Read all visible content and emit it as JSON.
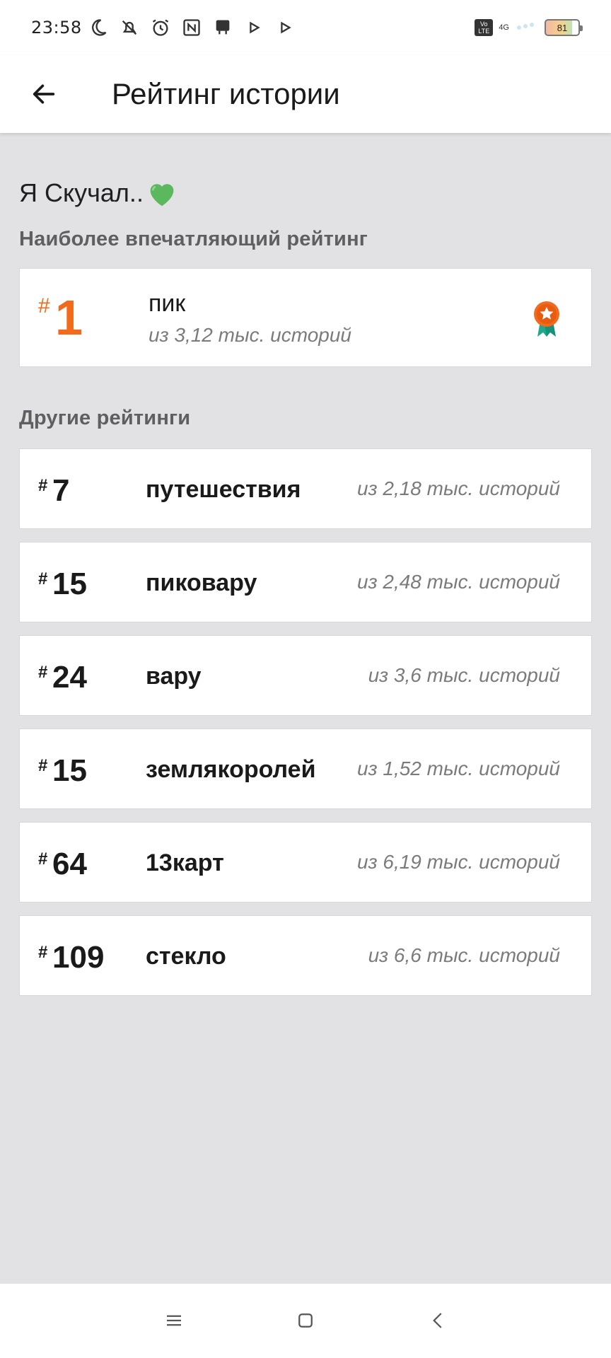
{
  "status_bar": {
    "time": "23:58",
    "volte": "Vo LTE",
    "signal": "4G",
    "battery": "81"
  },
  "app_bar": {
    "title": "Рейтинг истории"
  },
  "story": {
    "title": "Я Скучал.."
  },
  "top_section": {
    "label": "Наиболее впечатляющий рейтинг",
    "hash": "#",
    "rank": "1",
    "tag": "пик",
    "of_text": "из 3,12 тыс. историй"
  },
  "other_section": {
    "label": "Другие рейтинги",
    "items": [
      {
        "hash": "#",
        "rank": "7",
        "tag": "путешествия",
        "of_text": "из 2,18 тыс. историй"
      },
      {
        "hash": "#",
        "rank": "15",
        "tag": "пиковару",
        "of_text": "из 2,48 тыс. историй"
      },
      {
        "hash": "#",
        "rank": "24",
        "tag": "вару",
        "of_text": "из 3,6 тыс. историй"
      },
      {
        "hash": "#",
        "rank": "15",
        "tag": "землякоролей",
        "of_text": "из 1,52 тыс. историй"
      },
      {
        "hash": "#",
        "rank": "64",
        "tag": "13карт",
        "of_text": "из 6,19 тыс. историй"
      },
      {
        "hash": "#",
        "rank": "109",
        "tag": "стекло",
        "of_text": "из 6,6 тыс. историй"
      }
    ]
  },
  "colors": {
    "accent": "#f26a1b",
    "background": "#e2e1e3",
    "award_ribbon": "#1fa88e",
    "heart": "#5cb85c"
  },
  "icons": {
    "back": "arrow-left-icon",
    "heart": "green-heart-icon",
    "award": "award-medal-icon",
    "nav_menu": "menu-icon",
    "nav_home": "home-square-icon",
    "nav_back": "chevron-left-icon"
  }
}
